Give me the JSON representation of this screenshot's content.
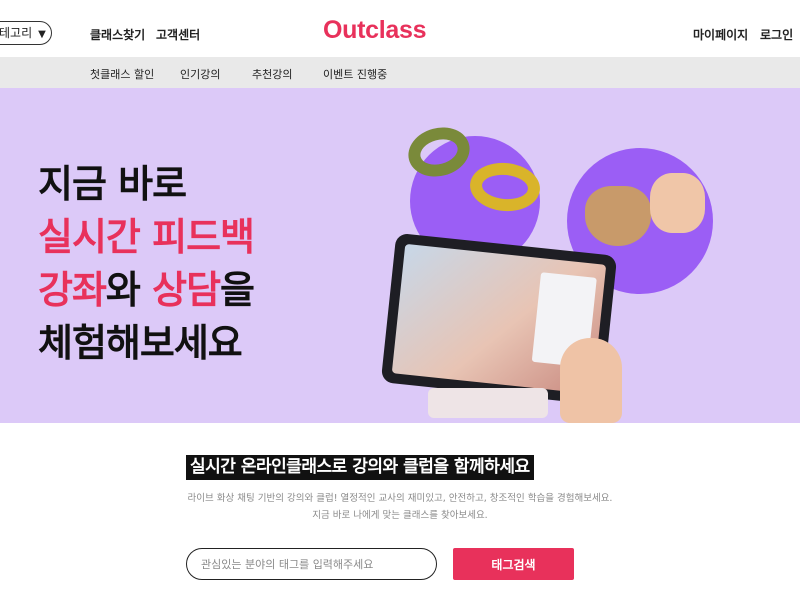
{
  "header": {
    "category_label": "테고리",
    "category_caret": "▼",
    "find_class": "클래스찾기",
    "support": "고객센터",
    "logo": "Outclass",
    "mypage": "마이페이지",
    "login": "로그인"
  },
  "subnav": {
    "items": [
      "첫클래스 할인",
      "인기강의",
      "추천강의",
      "이벤트 진행중"
    ]
  },
  "hero": {
    "line1": "지금 바로",
    "line2": "실시간 피드백",
    "line3_a": "강좌",
    "line3_b": "와 ",
    "line3_c": "상담",
    "line3_d": "을",
    "line4": "체험해보세요"
  },
  "intro": {
    "headline": "실시간 온라인클래스로 강의와 클럽을 함께하세요",
    "desc1": "라이브 화상 채팅 기반의 강의와 클럽! 열정적인 교사의 재미있고, 안전하고, 창조적인 학습을 경험해보세요.",
    "desc2": "지금 바로 나에게 맞는 클래스를 찾아보세요."
  },
  "search": {
    "placeholder": "관심있는 분야의 태그를 입력해주세요",
    "button": "태그검색"
  },
  "colors": {
    "brand": "#e8315b",
    "hero_bg": "#dcc9f8",
    "circle": "#9b5ef5"
  }
}
